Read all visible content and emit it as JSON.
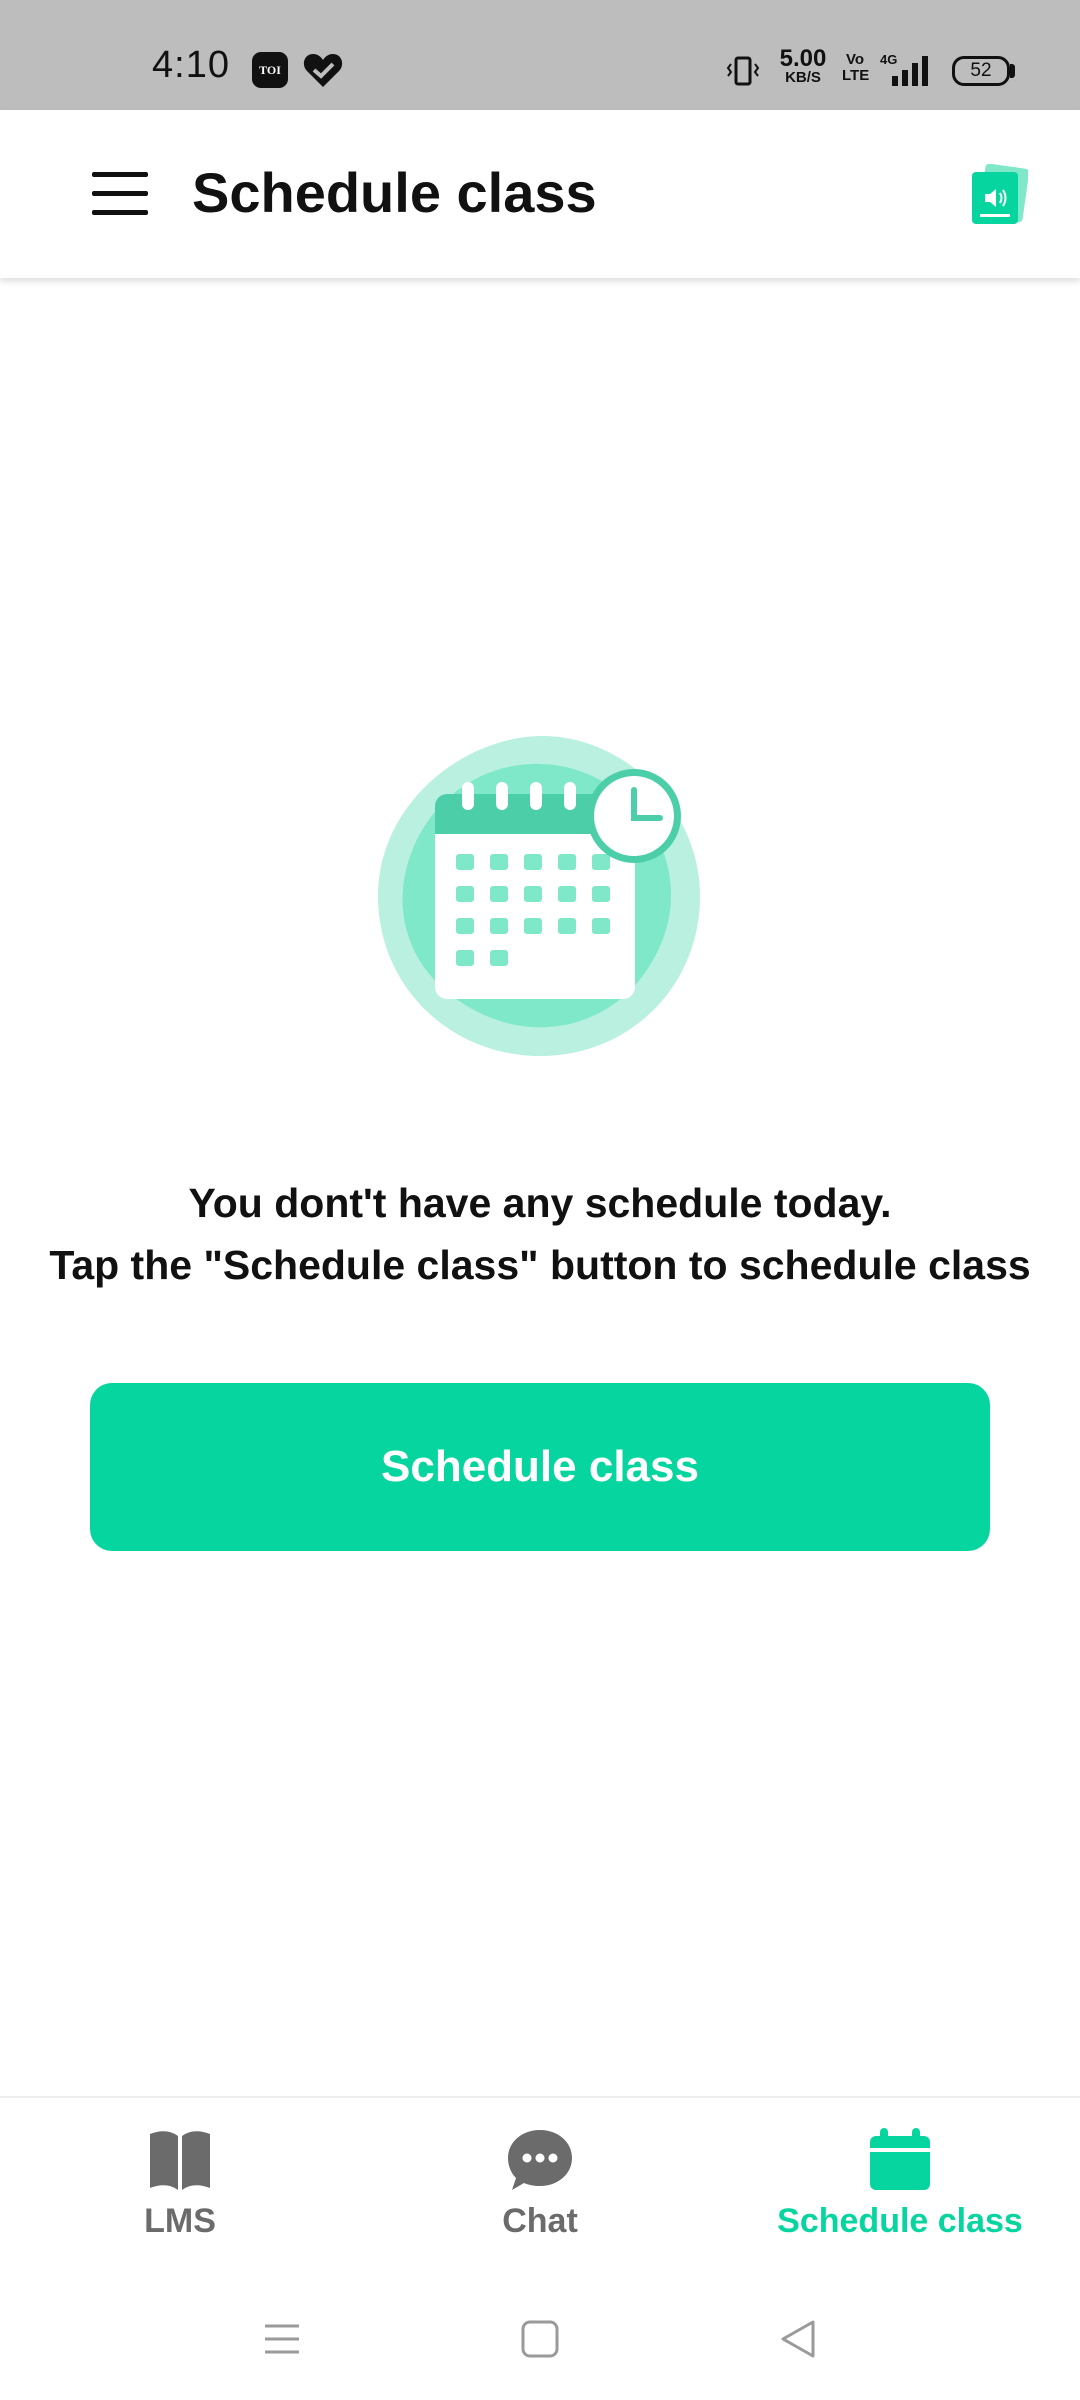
{
  "status_bar": {
    "time": "4:10",
    "toi_label": "TOI",
    "icons": [
      "toi-app-icon",
      "health-heart-icon",
      "vibrate-icon",
      "volte-icon",
      "signal-4g-icon",
      "battery-icon"
    ],
    "net_speed": "5.00",
    "net_speed_unit": "KB/S",
    "volte": "Vo LTE",
    "network": "4G",
    "battery": "52"
  },
  "app_bar": {
    "title": "Schedule class",
    "menu_icon": "hamburger-menu-icon",
    "action_icon": "announcement-icon"
  },
  "empty_state": {
    "illustration": "calendar-clock-icon",
    "line1": "You dont't have any schedule today.",
    "line2": "Tap the \"Schedule class\" button to schedule class"
  },
  "primary_button": {
    "label": "Schedule class"
  },
  "bottom_nav": {
    "items": [
      {
        "label": "LMS",
        "icon": "book-icon",
        "active": false
      },
      {
        "label": "Chat",
        "icon": "chat-bubble-icon",
        "active": false
      },
      {
        "label": "Schedule class",
        "icon": "calendar-icon",
        "active": true
      }
    ]
  },
  "colors": {
    "accent": "#07d59f",
    "inactive": "#6b6b6b",
    "status_bar_bg": "#bdbdbd"
  }
}
